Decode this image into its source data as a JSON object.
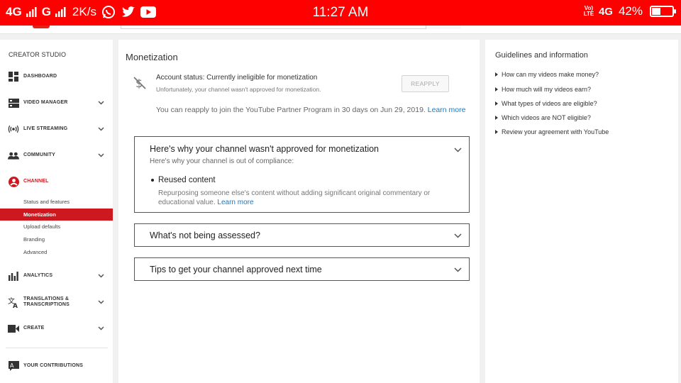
{
  "status_bar": {
    "network1": "4G",
    "network2": "G",
    "speed": "2K/s",
    "time": "11:27 AM",
    "volte": "Vo) LTE",
    "network3": "4G",
    "battery_percent": "42%",
    "battery_level": 0.42,
    "app_icons": [
      "whatsapp-icon",
      "twitter-icon",
      "youtube-icon"
    ]
  },
  "sidebar": {
    "title": "CREATOR STUDIO",
    "items": [
      {
        "label": "DASHBOARD",
        "icon": "dashboard-icon"
      },
      {
        "label": "VIDEO MANAGER",
        "icon": "video-manager-icon"
      },
      {
        "label": "LIVE STREAMING",
        "icon": "live-streaming-icon"
      },
      {
        "label": "COMMUNITY",
        "icon": "community-icon"
      },
      {
        "label": "CHANNEL",
        "icon": "channel-icon"
      },
      {
        "label": "ANALYTICS",
        "icon": "analytics-icon"
      },
      {
        "label": "TRANSLATIONS & TRANSCRIPTIONS",
        "icon": "translate-icon"
      },
      {
        "label": "CREATE",
        "icon": "create-icon"
      },
      {
        "label": "YOUR CONTRIBUTIONS",
        "icon": "contributions-icon"
      }
    ],
    "channel_subitems": [
      "Status and features",
      "Monetization",
      "Upload defaults",
      "Branding",
      "Advanced"
    ],
    "selected_subitem": "Monetization"
  },
  "main": {
    "title": "Monetization",
    "account_status": "Account status: Currently ineligible for monetization",
    "account_sub": "Unfortunately, your channel wasn't approved for monetization.",
    "reapply_label": "REAPPLY",
    "reapply_note": "You can reapply to join the YouTube Partner Program in 30 days on Jun 29, 2019.",
    "learn_more": "Learn more",
    "panels": [
      {
        "title": "Here's why your channel wasn't approved for monetization",
        "subtitle": "Here's why your channel is out of compliance:",
        "reason_title": "Reused content",
        "reason_desc": "Repurposing someone else's content without adding significant original commentary or educational value.",
        "reason_link": "Learn more"
      },
      {
        "title": "What's not being assessed?"
      },
      {
        "title": "Tips to get your channel approved next time"
      }
    ]
  },
  "right": {
    "title": "Guidelines and information",
    "links": [
      "How can my videos make money?",
      "How much will my videos earn?",
      "What types of videos are eligible?",
      "Which videos are NOT eligible?",
      "Review your agreement with YouTube"
    ]
  },
  "colors": {
    "status_bar": "#ff0000",
    "accent_red": "#cc181e",
    "link_blue": "#167ac6"
  }
}
